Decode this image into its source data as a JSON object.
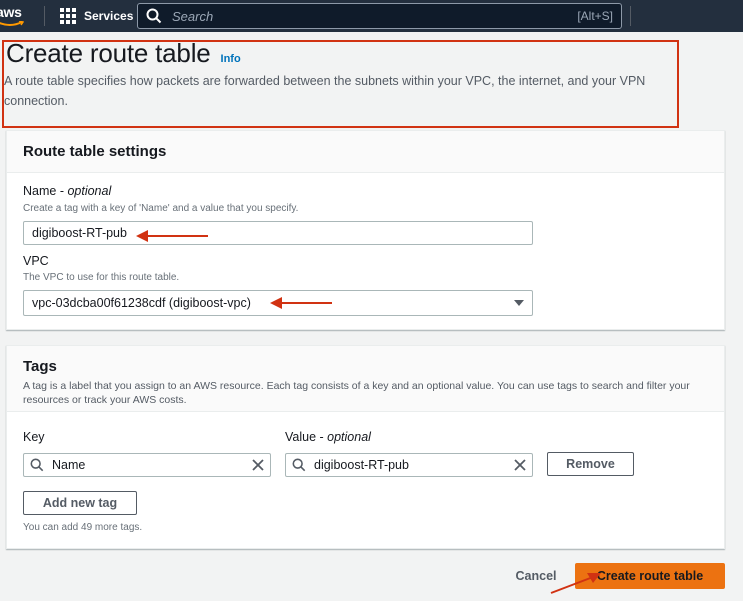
{
  "nav": {
    "logo_text": "aws",
    "services_label": "Services",
    "search_placeholder": "Search",
    "search_shortcut": "[Alt+S]"
  },
  "header": {
    "title": "Create route table",
    "info_label": "Info",
    "description": "A route table specifies how packets are forwarded between the subnets within your VPC, the internet, and your VPN connection."
  },
  "settings": {
    "title": "Route table settings",
    "name_label": "Name - ",
    "name_optional": "optional",
    "name_hint": "Create a tag with a key of 'Name' and a value that you specify.",
    "name_value": "digiboost-RT-pub",
    "vpc_label": "VPC",
    "vpc_hint": "The VPC to use for this route table.",
    "vpc_value": "vpc-03dcba00f61238cdf (digiboost-vpc)"
  },
  "tags": {
    "title": "Tags",
    "description": "A tag is a label that you assign to an AWS resource. Each tag consists of a key and an optional value. You can use tags to search and filter your resources or track your AWS costs.",
    "key_label": "Key",
    "value_label": "Value - ",
    "value_optional": "optional",
    "rows": [
      {
        "key": "Name",
        "value": "digiboost-RT-pub",
        "remove_label": "Remove"
      }
    ],
    "add_label": "Add new tag",
    "limit_text": "You can add 49 more tags."
  },
  "footer": {
    "cancel_label": "Cancel",
    "create_label": "Create route table"
  },
  "colors": {
    "nav_bg": "#232f3e",
    "primary": "#ec7211",
    "link": "#0073bb",
    "annotation": "#d13212"
  }
}
